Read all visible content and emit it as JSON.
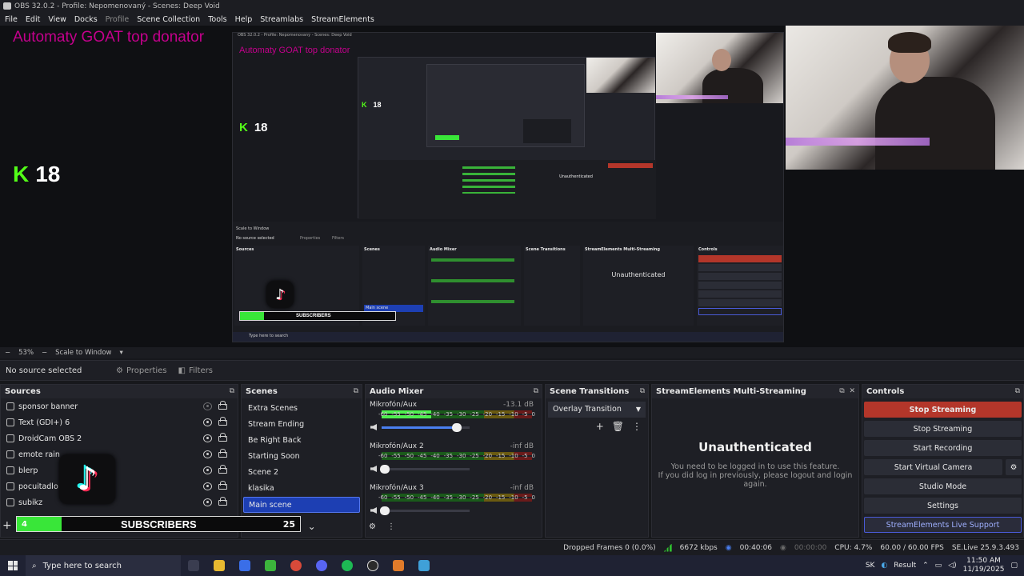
{
  "titlebar": {
    "title": "OBS 32.0.2 - Profile: Nepomenovaný - Scenes: Deep Void"
  },
  "menu": [
    "File",
    "Edit",
    "View",
    "Docks",
    "Profile",
    "Scene Collection",
    "Tools",
    "Help",
    "Streamlabs",
    "StreamElements"
  ],
  "preview": {
    "donor_text": "Automaty GOAT top donator",
    "kick_count": "18"
  },
  "zoom": {
    "value": "53%",
    "mode": "Scale to Window"
  },
  "source_toolbar": {
    "no_source": "No source selected",
    "properties": "Properties",
    "filters": "Filters"
  },
  "sources": {
    "title": "Sources",
    "items": [
      {
        "name": "sponsor banner",
        "visible": false
      },
      {
        "name": "Text (GDI+) 6",
        "visible": true
      },
      {
        "name": "DroidCam OBS 2",
        "visible": true
      },
      {
        "name": "emote rain",
        "visible": true
      },
      {
        "name": "blerp",
        "visible": true
      },
      {
        "name": "pocuitadlo vi",
        "visible": true
      },
      {
        "name": "subikz",
        "visible": true
      }
    ]
  },
  "scenes": {
    "title": "Scenes",
    "items": [
      "Extra Scenes",
      "Stream Ending",
      "Be Right Back",
      "Starting Soon",
      "Scene 2",
      "klasika",
      "Main scene"
    ],
    "selected": "Main scene"
  },
  "mixer": {
    "title": "Audio Mixer",
    "scale": [
      "-60",
      "-55",
      "-50",
      "-45",
      "-40",
      "-35",
      "-30",
      "-25",
      "-20",
      "-15",
      "-10",
      "-5",
      "0"
    ],
    "channels": [
      {
        "name": "Mikrofón/Aux",
        "db": "-13.1 dB",
        "level": 0.33,
        "volume": 0.82
      },
      {
        "name": "Mikrofón/Aux 2",
        "db": "-inf dB",
        "level": 0.0,
        "volume": 0.0
      },
      {
        "name": "Mikrofón/Aux 3",
        "db": "-inf dB",
        "level": 0.0,
        "volume": 0.0
      }
    ]
  },
  "transitions": {
    "title": "Scene Transitions",
    "selected": "Overlay Transition"
  },
  "multistream": {
    "title": "StreamElements Multi-Streaming",
    "heading": "Unauthenticated",
    "line1": "You need to be logged in to use this feature.",
    "line2": "If you did log in previously, please logout and login",
    "line3": "again."
  },
  "controls": {
    "title": "Controls",
    "buttons": [
      "Stop Streaming",
      "Stop Streaming",
      "Start Recording",
      "Start Virtual Camera",
      "Studio Mode",
      "Settings",
      "StreamElements Live Support"
    ]
  },
  "overlay": {
    "subs_count": "4",
    "subs_label": "SUBSCRIBERS",
    "subs_goal": "25"
  },
  "status": {
    "dropped": "Dropped Frames 0 (0.0%)",
    "kbps": "6672 kbps",
    "live_time": "00:40:06",
    "rec_time": "00:00:00",
    "cpu": "CPU: 4.7%",
    "fps": "60.00 / 60.00 FPS",
    "se_live": "SE.Live 25.9.3.493"
  },
  "taskbar": {
    "search": "Type here to search",
    "lang": "SK",
    "weather": "Result",
    "time": "11:50 AM",
    "date": "11/19/2025"
  },
  "colors": {
    "accent_red": "#b3362a",
    "selected_blue": "#1d3fb3",
    "kick_green": "#53fc18",
    "donor_pink": "#c4008c"
  }
}
